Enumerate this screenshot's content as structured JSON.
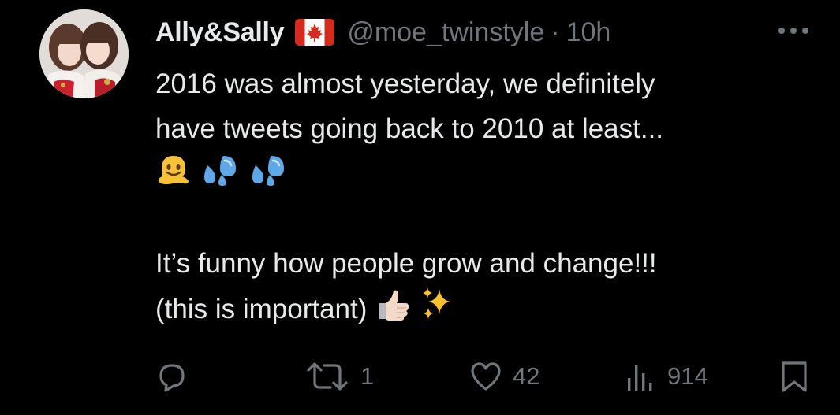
{
  "tweet": {
    "display_name": "Ally&Sally",
    "handle": "@moe_twinstyle",
    "separator": "·",
    "timestamp": "10h",
    "text_lines": {
      "l1": "2016 was almost yesterday, we definitely",
      "l2": "have tweets going back to 2010 at least...",
      "l4": "It’s funny how people grow and change!!!",
      "l5": "(this is important)"
    },
    "emojis": {
      "line3": [
        "melting-face-emoji",
        "sweat-droplets-emoji",
        "sweat-droplets-emoji"
      ],
      "line5": [
        "thumbs-up-light-skin-emoji",
        "sparkles-emoji"
      ]
    },
    "flag": "canada-flag-icon"
  },
  "actions": {
    "reply": {
      "icon": "reply-icon",
      "count": ""
    },
    "retweet": {
      "icon": "retweet-icon",
      "count": "1"
    },
    "like": {
      "icon": "heart-icon",
      "count": "42"
    },
    "views": {
      "icon": "views-chart-icon",
      "count": "914"
    },
    "bookmark": {
      "icon": "bookmark-icon"
    },
    "more": {
      "icon": "more-dots-icon"
    }
  },
  "colors": {
    "background": "#000000",
    "text_primary": "#e7e9ea",
    "text_secondary": "#71767b",
    "flag_red": "#d52b1e"
  }
}
